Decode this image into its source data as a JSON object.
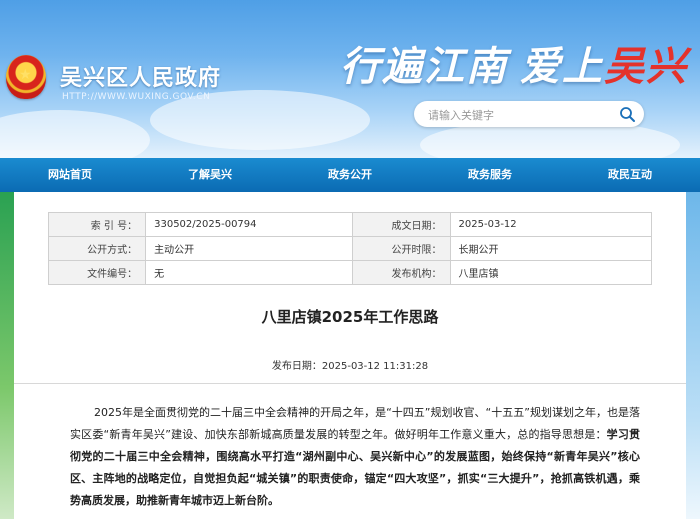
{
  "header": {
    "site_title": "吴兴区人民政府",
    "site_url": "HTTP://WWW.WUXING.GOV.CN",
    "slogan_part1": "行遍江南",
    "slogan_part2": "爱上",
    "slogan_part3": "吴兴",
    "search_placeholder": "请输入关键字"
  },
  "nav": {
    "items": [
      "网站首页",
      "了解吴兴",
      "政务公开",
      "政务服务",
      "政民互动"
    ]
  },
  "meta": {
    "rows": [
      {
        "k1": "索 引 号：",
        "v1": "330502/2025-00794",
        "k2": "成文日期：",
        "v2": "2025-03-12"
      },
      {
        "k1": "公开方式：",
        "v1": "主动公开",
        "k2": "公开时限：",
        "v2": "长期公开"
      },
      {
        "k1": "文件编号：",
        "v1": "无",
        "k2": "发布机构：",
        "v2": "八里店镇"
      }
    ]
  },
  "article": {
    "title": "八里店镇2025年工作思路",
    "pubdate_label": "发布日期：",
    "pubdate_value": "2025-03-12 11:31:28",
    "para_intro": "2025年是全面贯彻党的二十届三中全会精神的开局之年，是“十四五”规划收官、“十五五”规划谋划之年，也是落实区委“新青年吴兴”建设、加快东部新城高质量发展的转型之年。做好明年工作意义重大，总的指导思想是：",
    "para_bold": "学习贯彻党的二十届三中全会精神，围绕高水平打造“湖州副中心、吴兴新中心”的发展蓝图，始终保持“新青年吴兴”核心区、主阵地的战略定位，自觉担负起“城关镇”的职责使命，锚定“四大攻坚”，抓实“三大提升”，抢抓高铁机遇，乘势高质发展，助推新青年城市迈上新台阶。"
  },
  "colors": {
    "nav": "#0b6bb3",
    "slogan_red": "#e4322b",
    "emblem_red": "#d8241c"
  }
}
